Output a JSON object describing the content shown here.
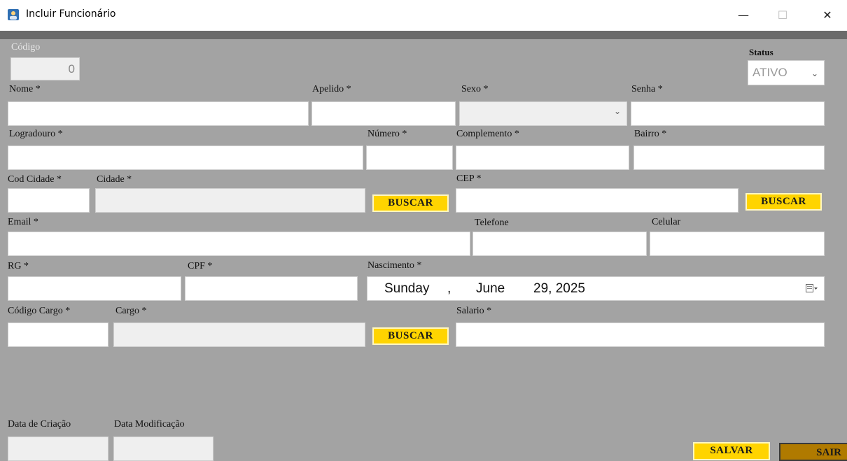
{
  "window": {
    "title": "Incluir Funcionário",
    "minimize_glyph": "—",
    "maximize_glyph": "☐",
    "close_glyph": "✕"
  },
  "form": {
    "codigo": {
      "label": "Código",
      "value": "0"
    },
    "status": {
      "label": "Status",
      "value": "ATIVO"
    },
    "nome": {
      "label": "Nome *",
      "value": ""
    },
    "apelido": {
      "label": "Apelido *",
      "value": ""
    },
    "sexo": {
      "label": "Sexo *",
      "value": ""
    },
    "senha": {
      "label": "Senha *",
      "value": ""
    },
    "logradouro": {
      "label": "Logradouro *",
      "value": ""
    },
    "numero": {
      "label": "Número *",
      "value": ""
    },
    "complemento": {
      "label": "Complemento *",
      "value": ""
    },
    "bairro": {
      "label": "Bairro *",
      "value": ""
    },
    "cod_cidade": {
      "label": "Cod Cidade *",
      "value": ""
    },
    "cidade": {
      "label": "Cidade *",
      "value": ""
    },
    "cep": {
      "label": "CEP *",
      "value": ""
    },
    "email": {
      "label": "Email *",
      "value": ""
    },
    "telefone": {
      "label": "Telefone",
      "value": ""
    },
    "celular": {
      "label": "Celular",
      "value": ""
    },
    "rg": {
      "label": "RG *",
      "value": ""
    },
    "cpf": {
      "label": "CPF *",
      "value": ""
    },
    "nascimento": {
      "label": "Nascimento *",
      "weekday": "Sunday",
      "sep": ",",
      "month": "June",
      "day_year": "29, 2025"
    },
    "codigo_cargo": {
      "label": "Código Cargo *",
      "value": ""
    },
    "cargo": {
      "label": "Cargo *",
      "value": ""
    },
    "salario": {
      "label": "Salario *",
      "value": ""
    },
    "data_criacao": {
      "label": "Data de Criação",
      "value": ""
    },
    "data_modificacao": {
      "label": "Data Modificação",
      "value": ""
    }
  },
  "buttons": {
    "buscar": "BUSCAR",
    "salvar": "SALVAR",
    "sair": "SAIR"
  },
  "colors": {
    "form_bg": "#a3a3a3",
    "button_yellow": "#ffd400",
    "button_exit": "#b07a00"
  }
}
